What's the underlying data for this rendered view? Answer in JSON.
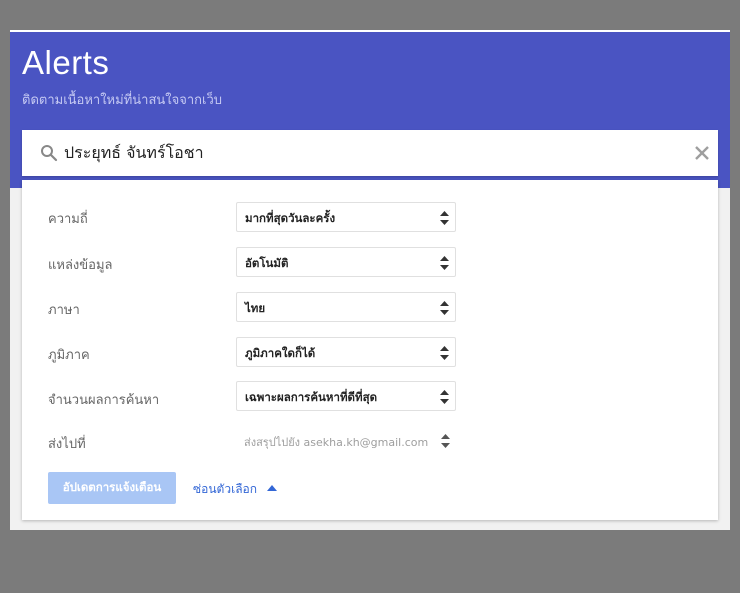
{
  "header": {
    "title": "Alerts",
    "subtitle": "ติดตามเนื้อหาใหม่ที่น่าสนใจจากเว็บ"
  },
  "search": {
    "value": "ประยุทธ์ จันทร์โอชา",
    "icon": "search-icon",
    "clear_icon": "close-icon"
  },
  "options": [
    {
      "label": "ความถี่",
      "value": "มากที่สุดวันละครั้ง"
    },
    {
      "label": "แหล่งข้อมูล",
      "value": "อัตโนมัติ"
    },
    {
      "label": "ภาษา",
      "value": "ไทย"
    },
    {
      "label": "ภูมิภาค",
      "value": "ภูมิภาคใดก็ได้"
    },
    {
      "label": "จำนวนผลการค้นหา",
      "value": "เฉพาะผลการค้นหาที่ดีที่สุด"
    },
    {
      "label": "ส่งไปที่",
      "value": "ส่งสรุปไปยัง asekha.kh@gmail.com"
    }
  ],
  "actions": {
    "update_label": "อัปเดตการแจ้งเตือน",
    "hide_options_label": "ซ่อนตัวเลือก"
  },
  "colors": {
    "header_bg": "#4a54c2",
    "button_bg": "#a9c6f5",
    "link": "#3367d6"
  }
}
